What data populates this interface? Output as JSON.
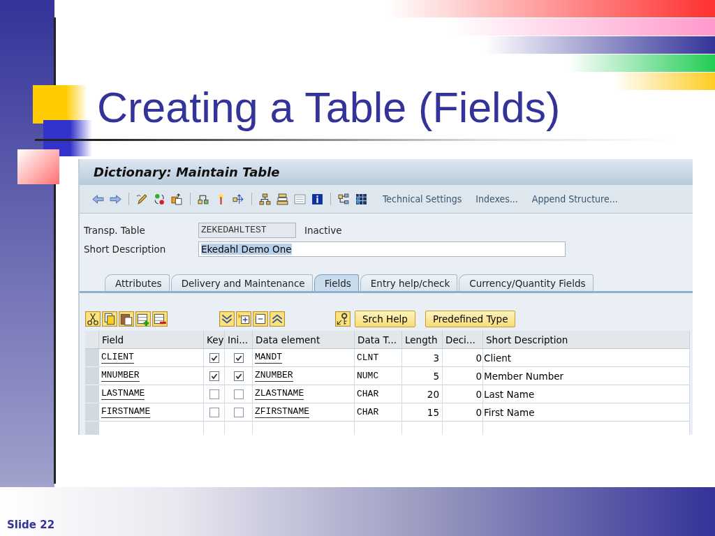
{
  "slide": {
    "title": "Creating a Table (Fields)",
    "footer": "Slide 22"
  },
  "window": {
    "title": "Dictionary: Maintain Table"
  },
  "toolbar": {
    "buttons": [
      "Technical Settings",
      "Indexes...",
      "Append Structure..."
    ]
  },
  "header_fields": [
    {
      "label": "Transp. Table",
      "value": "ZEKEDAHLTEST",
      "kind": "readonly",
      "status": "Inactive",
      "text_selected": false
    },
    {
      "label": "Short Description",
      "value": "Ekedahl Demo One",
      "kind": "editable",
      "text_selected": true
    }
  ],
  "tabs": [
    {
      "label": "Attributes",
      "selected": false
    },
    {
      "label": "Delivery and Maintenance",
      "selected": false
    },
    {
      "label": "Fields",
      "selected": true
    },
    {
      "label": "Entry help/check",
      "selected": false
    },
    {
      "label": "Currency/Quantity Fields",
      "selected": false
    }
  ],
  "table_toolbar": {
    "buttons": [
      "Srch Help",
      "Predefined Type"
    ]
  },
  "table": {
    "columns": [
      "Field",
      "Key",
      "Ini...",
      "Data element",
      "Data T...",
      "Length",
      "Deci...",
      "Short Description"
    ],
    "rows": [
      {
        "field": "CLIENT",
        "key": true,
        "initial": true,
        "data_element": "MANDT",
        "data_type": "CLNT",
        "length": "3",
        "decimals": "0",
        "short_description": "Client"
      },
      {
        "field": "MNUMBER",
        "key": true,
        "initial": true,
        "data_element": "ZNUMBER",
        "data_type": "NUMC",
        "length": "5",
        "decimals": "0",
        "short_description": "Member Number"
      },
      {
        "field": "LASTNAME",
        "key": false,
        "initial": false,
        "data_element": "ZLASTNAME",
        "data_type": "CHAR",
        "length": "20",
        "decimals": "0",
        "short_description": "Last Name"
      },
      {
        "field": "FIRSTNAME",
        "key": false,
        "initial": false,
        "data_element": "ZFIRSTNAME",
        "data_type": "CHAR",
        "length": "15",
        "decimals": "0",
        "short_description": "First Name"
      }
    ]
  }
}
